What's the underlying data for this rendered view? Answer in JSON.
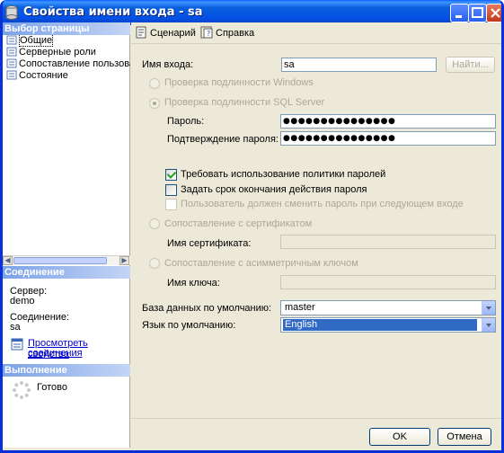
{
  "window": {
    "title": "Свойства имени входа - sa"
  },
  "left": {
    "pages_header": "Выбор страницы",
    "pages": [
      {
        "label": "Общие",
        "selected": true
      },
      {
        "label": "Серверные роли"
      },
      {
        "label": "Сопоставление пользователей"
      },
      {
        "label": "Состояние"
      }
    ],
    "connection_header": "Соединение",
    "server_label": "Сервер:",
    "server_value": "demo",
    "connection_label": "Соединение:",
    "connection_value": "sa",
    "view_link_1": "Просмотреть свойства",
    "view_link_2": "соединения",
    "progress_header": "Выполнение",
    "status": "Готово"
  },
  "toolbar": {
    "script_label": "Сценарий",
    "help_label": "Справка"
  },
  "form": {
    "login_label": "Имя входа:",
    "login_value": "sa",
    "find_button": "Найти...",
    "windows_auth": "Проверка подлинности Windows",
    "sql_auth": "Проверка подлинности SQL Server",
    "password_label": "Пароль:",
    "password_value": "●●●●●●●●●●●●●●●",
    "confirm_label": "Подтверждение пароля:",
    "confirm_value": "●●●●●●●●●●●●●●●",
    "enforce_policy": "Требовать использование политики паролей",
    "enforce_policy_checked": true,
    "enforce_expiration": "Задать срок окончания действия пароля",
    "enforce_expiration_checked": false,
    "must_change": "Пользователь должен сменить пароль при следующем входе",
    "cert_mapping": "Сопоставление с сертификатом",
    "cert_name_label": "Имя сертификата:",
    "asym_mapping": "Сопоставление с асимметричным ключом",
    "key_name_label": "Имя ключа:",
    "default_db_label": "База данных по умолчанию:",
    "default_db_value": "master",
    "default_lang_label": "Язык по умолчанию:",
    "default_lang_value": "English"
  },
  "buttons": {
    "ok": "OK",
    "cancel": "Отмена"
  },
  "colors": {
    "title_bar": "#0451e6",
    "section_header": "#7ba2e7",
    "selection": "#316ac5"
  }
}
